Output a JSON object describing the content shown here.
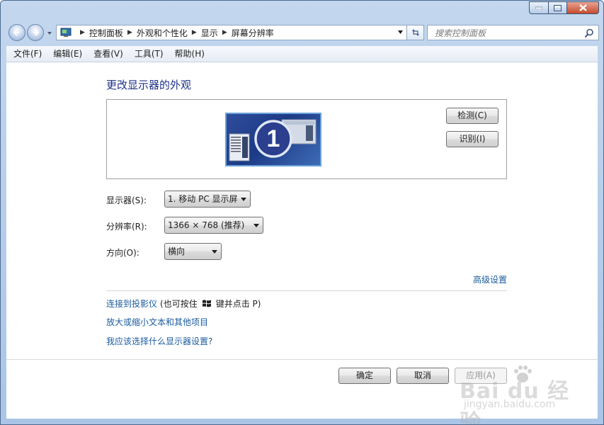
{
  "breadcrumb": [
    "控制面板",
    "外观和个性化",
    "显示",
    "屏幕分辨率"
  ],
  "search": {
    "placeholder": "搜索控制面板"
  },
  "menu": [
    "文件(F)",
    "编辑(E)",
    "查看(V)",
    "工具(T)",
    "帮助(H)"
  ],
  "page": {
    "title": "更改显示器的外观",
    "monitor_number": "1",
    "detect_button": "检测(C)",
    "identify_button": "识别(I)"
  },
  "settings": {
    "display_label": "显示器(S):",
    "display_value": "1. 移动 PC 显示屏",
    "resolution_label": "分辨率(R):",
    "resolution_value": "1366 × 768 (推荐)",
    "orientation_label": "方向(O):",
    "orientation_value": "横向"
  },
  "links": {
    "advanced": "高级设置",
    "projector": "连接到投影仪",
    "projector_hint_pre": "(也可按住",
    "projector_hint_post": "键并点击 P)",
    "zoom_text": "放大或缩小文本和其他项目",
    "which_settings": "我应该选择什么显示器设置?"
  },
  "buttons": {
    "ok": "确定",
    "cancel": "取消",
    "apply": "应用(A)"
  },
  "watermark": {
    "main": "Bai du 经验",
    "sub": "jingyan.baidu.com"
  },
  "colors": {
    "link": "#1a5b9e",
    "title": "#1e3287",
    "frame": "#aac5e6"
  },
  "icons": {
    "back": "back-arrow-icon",
    "forward": "forward-arrow-icon",
    "refresh": "refresh-icon",
    "search": "search-icon",
    "windows": "windows-logo-icon"
  }
}
